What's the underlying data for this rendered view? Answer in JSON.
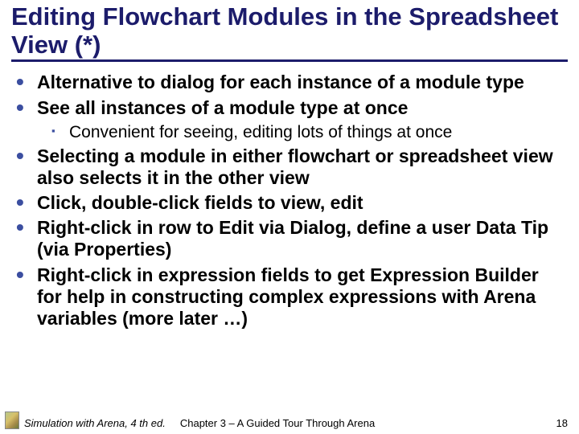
{
  "title": "Editing Flowchart Modules in the Spreadsheet View (*)",
  "bullets": {
    "b0": "Alternative to dialog for each instance of a module type",
    "b1": "See all instances of a module type at once",
    "b1s0": "Convenient for seeing, editing lots of things at once",
    "b2": "Selecting a module in either flowchart or spreadsheet view also selects it in the other view",
    "b3": "Click, double-click fields to view, edit",
    "b4": "Right-click in row to Edit via Dialog, define a user Data Tip (via Properties)",
    "b5": "Right-click in expression fields to get Expression Builder for help in constructing complex expressions with Arena variables (more later …)"
  },
  "footer": {
    "book": "Simulation with Arena, 4 th ed.",
    "chapter": "Chapter 3 – A Guided Tour Through Arena",
    "page": "18"
  }
}
